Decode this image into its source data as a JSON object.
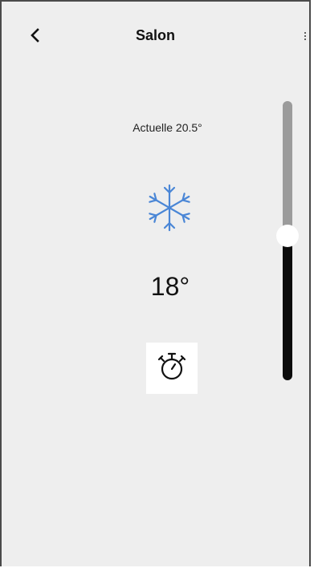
{
  "header": {
    "title": "Salon",
    "back_icon": "chevron-left-icon",
    "menu_icon": "more-vertical-icon"
  },
  "thermostat": {
    "current_label": "Actuelle 20.5°",
    "mode_icon": "snowflake-icon",
    "setpoint": "18°",
    "timer_icon": "stopwatch-icon",
    "slider_level": 0.52
  },
  "colors": {
    "background": "#eeeeee",
    "snowflake": "#4a86d6",
    "slider_upper": "#9b9b9b",
    "slider_lower": "#0b0b0b"
  }
}
